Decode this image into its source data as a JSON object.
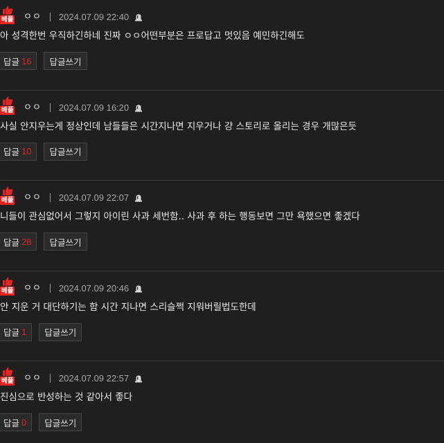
{
  "badge_label": "베플",
  "reply_label": "답글",
  "write_reply_label": "답글쓰기",
  "colors": {
    "badge": "#e6231e",
    "count": "#e6231e",
    "background": "#1f1f1f"
  },
  "icons": {
    "badge": "thumbs-up-icon",
    "ip": "ip-lamp-icon"
  },
  "comments": [
    {
      "nickname": "ㅇㅇ",
      "date": "2024.07.09 22:40",
      "text": "아 성격한번 우직하긴하네 진짜 ㅇㅇ어떤부분은 프로답고 멋있음 예민하긴해도",
      "reply_count": "16"
    },
    {
      "nickname": "ㅇㅇ",
      "date": "2024.07.09 16:20",
      "text": "사실 안지우는게 정상인데 남들들은 시간지나면 지우거나 걍 스토리로 올리는 경우 개많은듯",
      "reply_count": "10"
    },
    {
      "nickname": "ㅇㅇ",
      "date": "2024.07.09 22:07",
      "text": "니들이 관심없어서 그렇지 아이린 사과 세번함.. 사과 후 하는 행동보면 그만 욕했으면 좋겠다",
      "reply_count": "28"
    },
    {
      "nickname": "ㅇㅇ",
      "date": "2024.07.09 20:46",
      "text": "안 지운 거 대단하기는 함 시간 지나면 스리슬쩍 지워버릴법도한데",
      "reply_count": "1"
    },
    {
      "nickname": "ㅇㅇ",
      "date": "2024.07.09 22:57",
      "text": "진심으로 반성하는 것 같아서 좋다",
      "reply_count": "0"
    }
  ]
}
